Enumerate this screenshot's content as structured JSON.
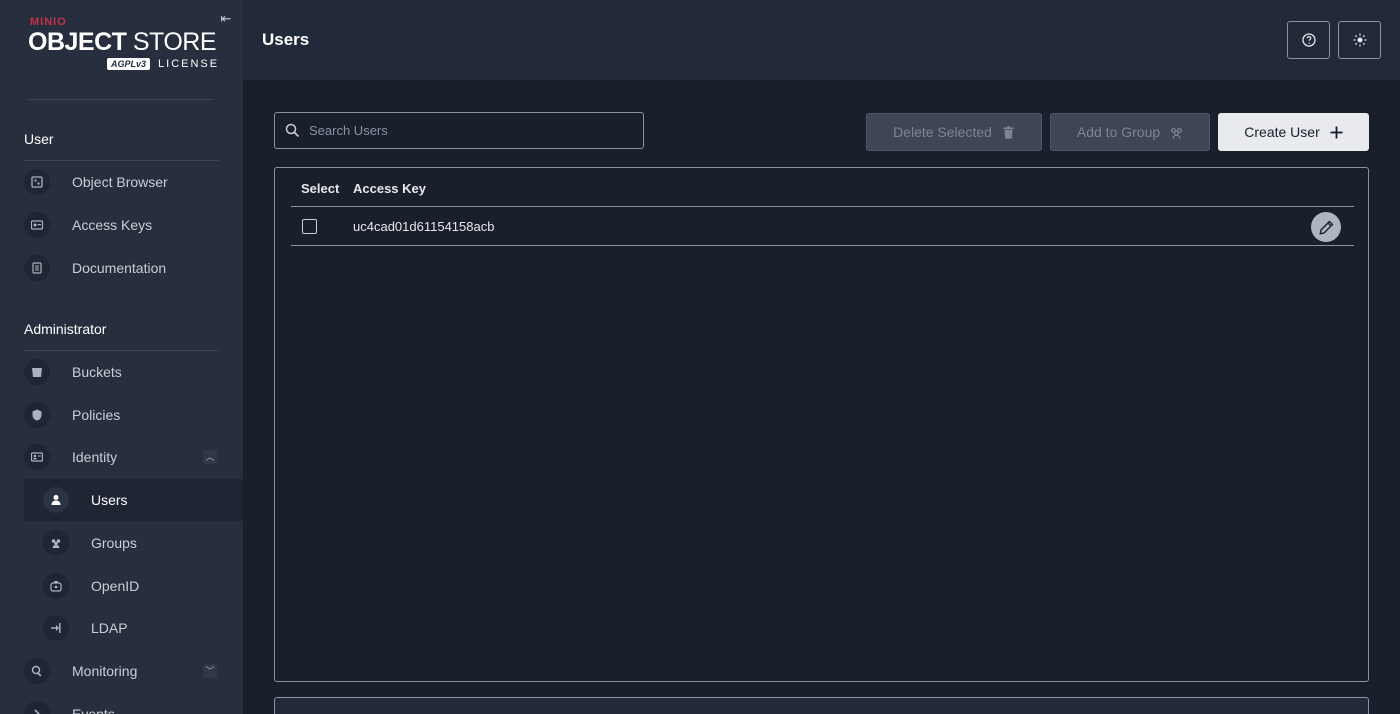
{
  "logo": {
    "brand": "MINIO",
    "product_bold": "OBJECT",
    "product_light": "STORE",
    "badge": "AGPLv3",
    "license": "LICENSE"
  },
  "sidebar": {
    "sections": [
      {
        "title": "User"
      },
      {
        "title": "Administrator"
      }
    ],
    "user_items": [
      {
        "label": "Object Browser",
        "icon": "object-browser-icon"
      },
      {
        "label": "Access Keys",
        "icon": "access-keys-icon"
      },
      {
        "label": "Documentation",
        "icon": "documentation-icon"
      }
    ],
    "admin_items": [
      {
        "label": "Buckets",
        "icon": "bucket-icon"
      },
      {
        "label": "Policies",
        "icon": "policy-icon"
      },
      {
        "label": "Identity",
        "icon": "identity-icon",
        "expanded": true
      },
      {
        "label": "Users",
        "icon": "user-icon",
        "active": true
      },
      {
        "label": "Groups",
        "icon": "groups-icon"
      },
      {
        "label": "OpenID",
        "icon": "openid-icon"
      },
      {
        "label": "LDAP",
        "icon": "ldap-icon"
      },
      {
        "label": "Monitoring",
        "icon": "monitoring-icon",
        "expanded": false
      },
      {
        "label": "Events",
        "icon": "events-icon"
      }
    ]
  },
  "header": {
    "title": "Users"
  },
  "search": {
    "placeholder": "Search Users",
    "value": ""
  },
  "actions": {
    "delete_label": "Delete Selected",
    "add_group_label": "Add to Group",
    "create_label": "Create User"
  },
  "table": {
    "columns": [
      "Select",
      "Access Key"
    ],
    "rows": [
      {
        "access_key": "uc4cad01d61154158acb",
        "selected": false
      }
    ]
  },
  "colors": {
    "sidebar_bg": "#272f3e",
    "header_bg": "#222938",
    "main_bg": "#1a1f2c",
    "brand_red": "#c72e49"
  }
}
